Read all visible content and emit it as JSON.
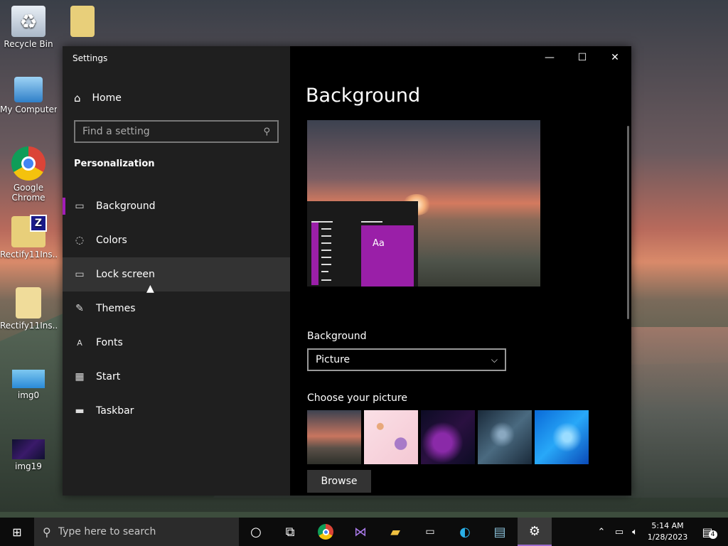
{
  "desktop": {
    "icons": [
      {
        "label": "Recycle Bin"
      },
      {
        "label": "My Computer"
      },
      {
        "label": "Google Chrome"
      },
      {
        "label": "Rectify11Ins..."
      },
      {
        "label": "Rectify11Ins..."
      },
      {
        "label": "img0"
      },
      {
        "label": "img19"
      }
    ]
  },
  "window": {
    "title": "Settings",
    "home_label": "Home",
    "search_placeholder": "Find a setting",
    "section_title": "Personalization",
    "nav": [
      {
        "label": "Background",
        "icon": "image-icon"
      },
      {
        "label": "Colors",
        "icon": "palette-icon"
      },
      {
        "label": "Lock screen",
        "icon": "lock-screen-icon"
      },
      {
        "label": "Themes",
        "icon": "themes-icon"
      },
      {
        "label": "Fonts",
        "icon": "fonts-icon"
      },
      {
        "label": "Start",
        "icon": "start-icon"
      },
      {
        "label": "Taskbar",
        "icon": "taskbar-icon"
      }
    ],
    "active_nav": "Background",
    "hover_nav": "Lock screen"
  },
  "content": {
    "heading": "Background",
    "preview_tile_text": "Aa",
    "background_label": "Background",
    "background_value": "Picture",
    "choose_label": "Choose your picture",
    "browse_label": "Browse"
  },
  "taskbar": {
    "search_placeholder": "Type here to search",
    "time": "5:14 AM",
    "date": "1/28/2023",
    "notification_count": "4"
  },
  "colors": {
    "accent": "#9a1fa8",
    "window_left": "#1f1f1f",
    "window_right": "#000000"
  }
}
